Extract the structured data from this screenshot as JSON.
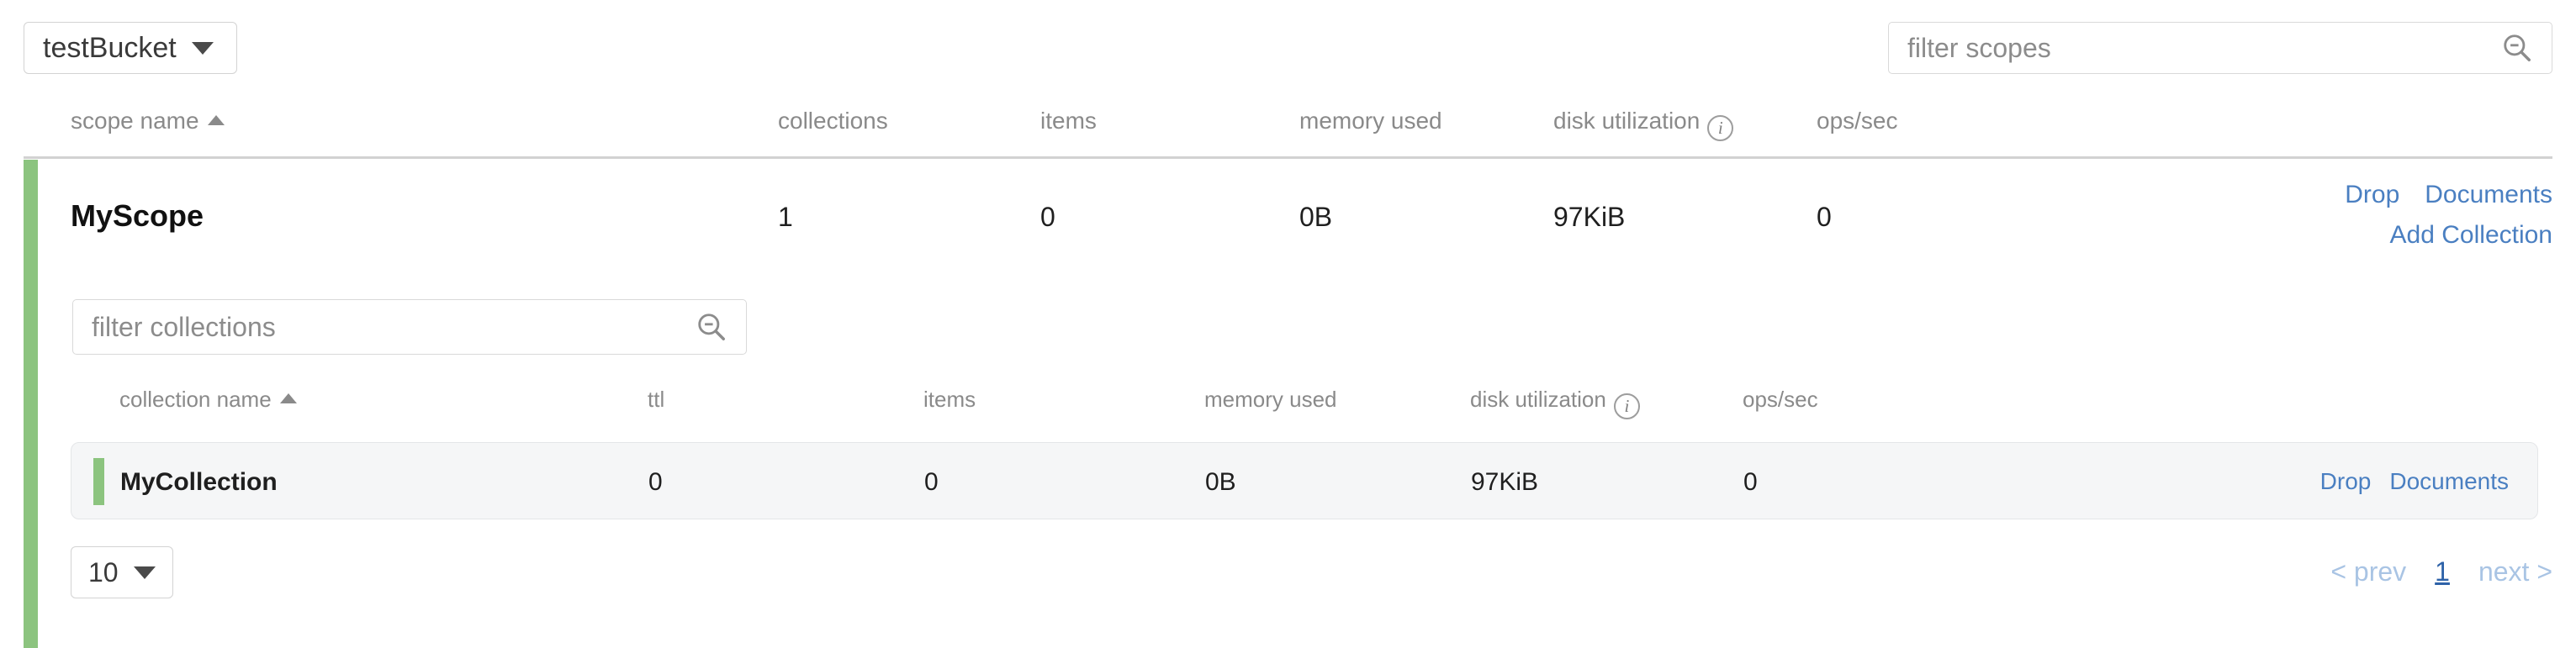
{
  "header": {
    "bucket_name": "testBucket",
    "bucket_caret_icon": "chevron-down-icon",
    "scope_filter_placeholder": "filter scopes",
    "scope_filter_value": "",
    "search_icon": "search-icon"
  },
  "scope_table": {
    "columns": [
      {
        "label": "scope name",
        "sorted": "asc",
        "sort_icon": "sort-ascending-icon"
      },
      {
        "label": "collections"
      },
      {
        "label": "items"
      },
      {
        "label": "memory used"
      },
      {
        "label": "disk utilization",
        "info_icon": "info-icon"
      },
      {
        "label": "ops/sec"
      }
    ],
    "rows": [
      {
        "name": "MyScope",
        "collections": "1",
        "items": "0",
        "memory_used": "0B",
        "disk_utilization": "97KiB",
        "ops_sec": "0",
        "actions": [
          "Drop",
          "Documents"
        ],
        "secondary_actions": [
          "Add Collection"
        ]
      }
    ]
  },
  "collection_panel": {
    "filter_placeholder": "filter collections",
    "filter_value": "",
    "search_icon": "search-icon",
    "columns": [
      {
        "label": "collection name",
        "sorted": "asc",
        "sort_icon": "sort-ascending-icon"
      },
      {
        "label": "ttl"
      },
      {
        "label": "items"
      },
      {
        "label": "memory used"
      },
      {
        "label": "disk utilization",
        "info_icon": "info-icon"
      },
      {
        "label": "ops/sec"
      }
    ],
    "rows": [
      {
        "name": "MyCollection",
        "ttl": "0",
        "items": "0",
        "memory_used": "0B",
        "disk_utilization": "97KiB",
        "ops_sec": "0",
        "actions": [
          "Drop",
          "Documents"
        ]
      }
    ],
    "pagination": {
      "page_size": "10",
      "page_size_caret_icon": "chevron-down-icon",
      "prev_label": "< prev",
      "current_page": "1",
      "next_label": "next >"
    }
  },
  "colors": {
    "accent_green": "#8cc47f",
    "link_blue": "#4a7fc1",
    "link_blue_disabled": "#a9c4e4",
    "row_background": "#f5f6f7",
    "muted_text": "#8a8a8a"
  }
}
